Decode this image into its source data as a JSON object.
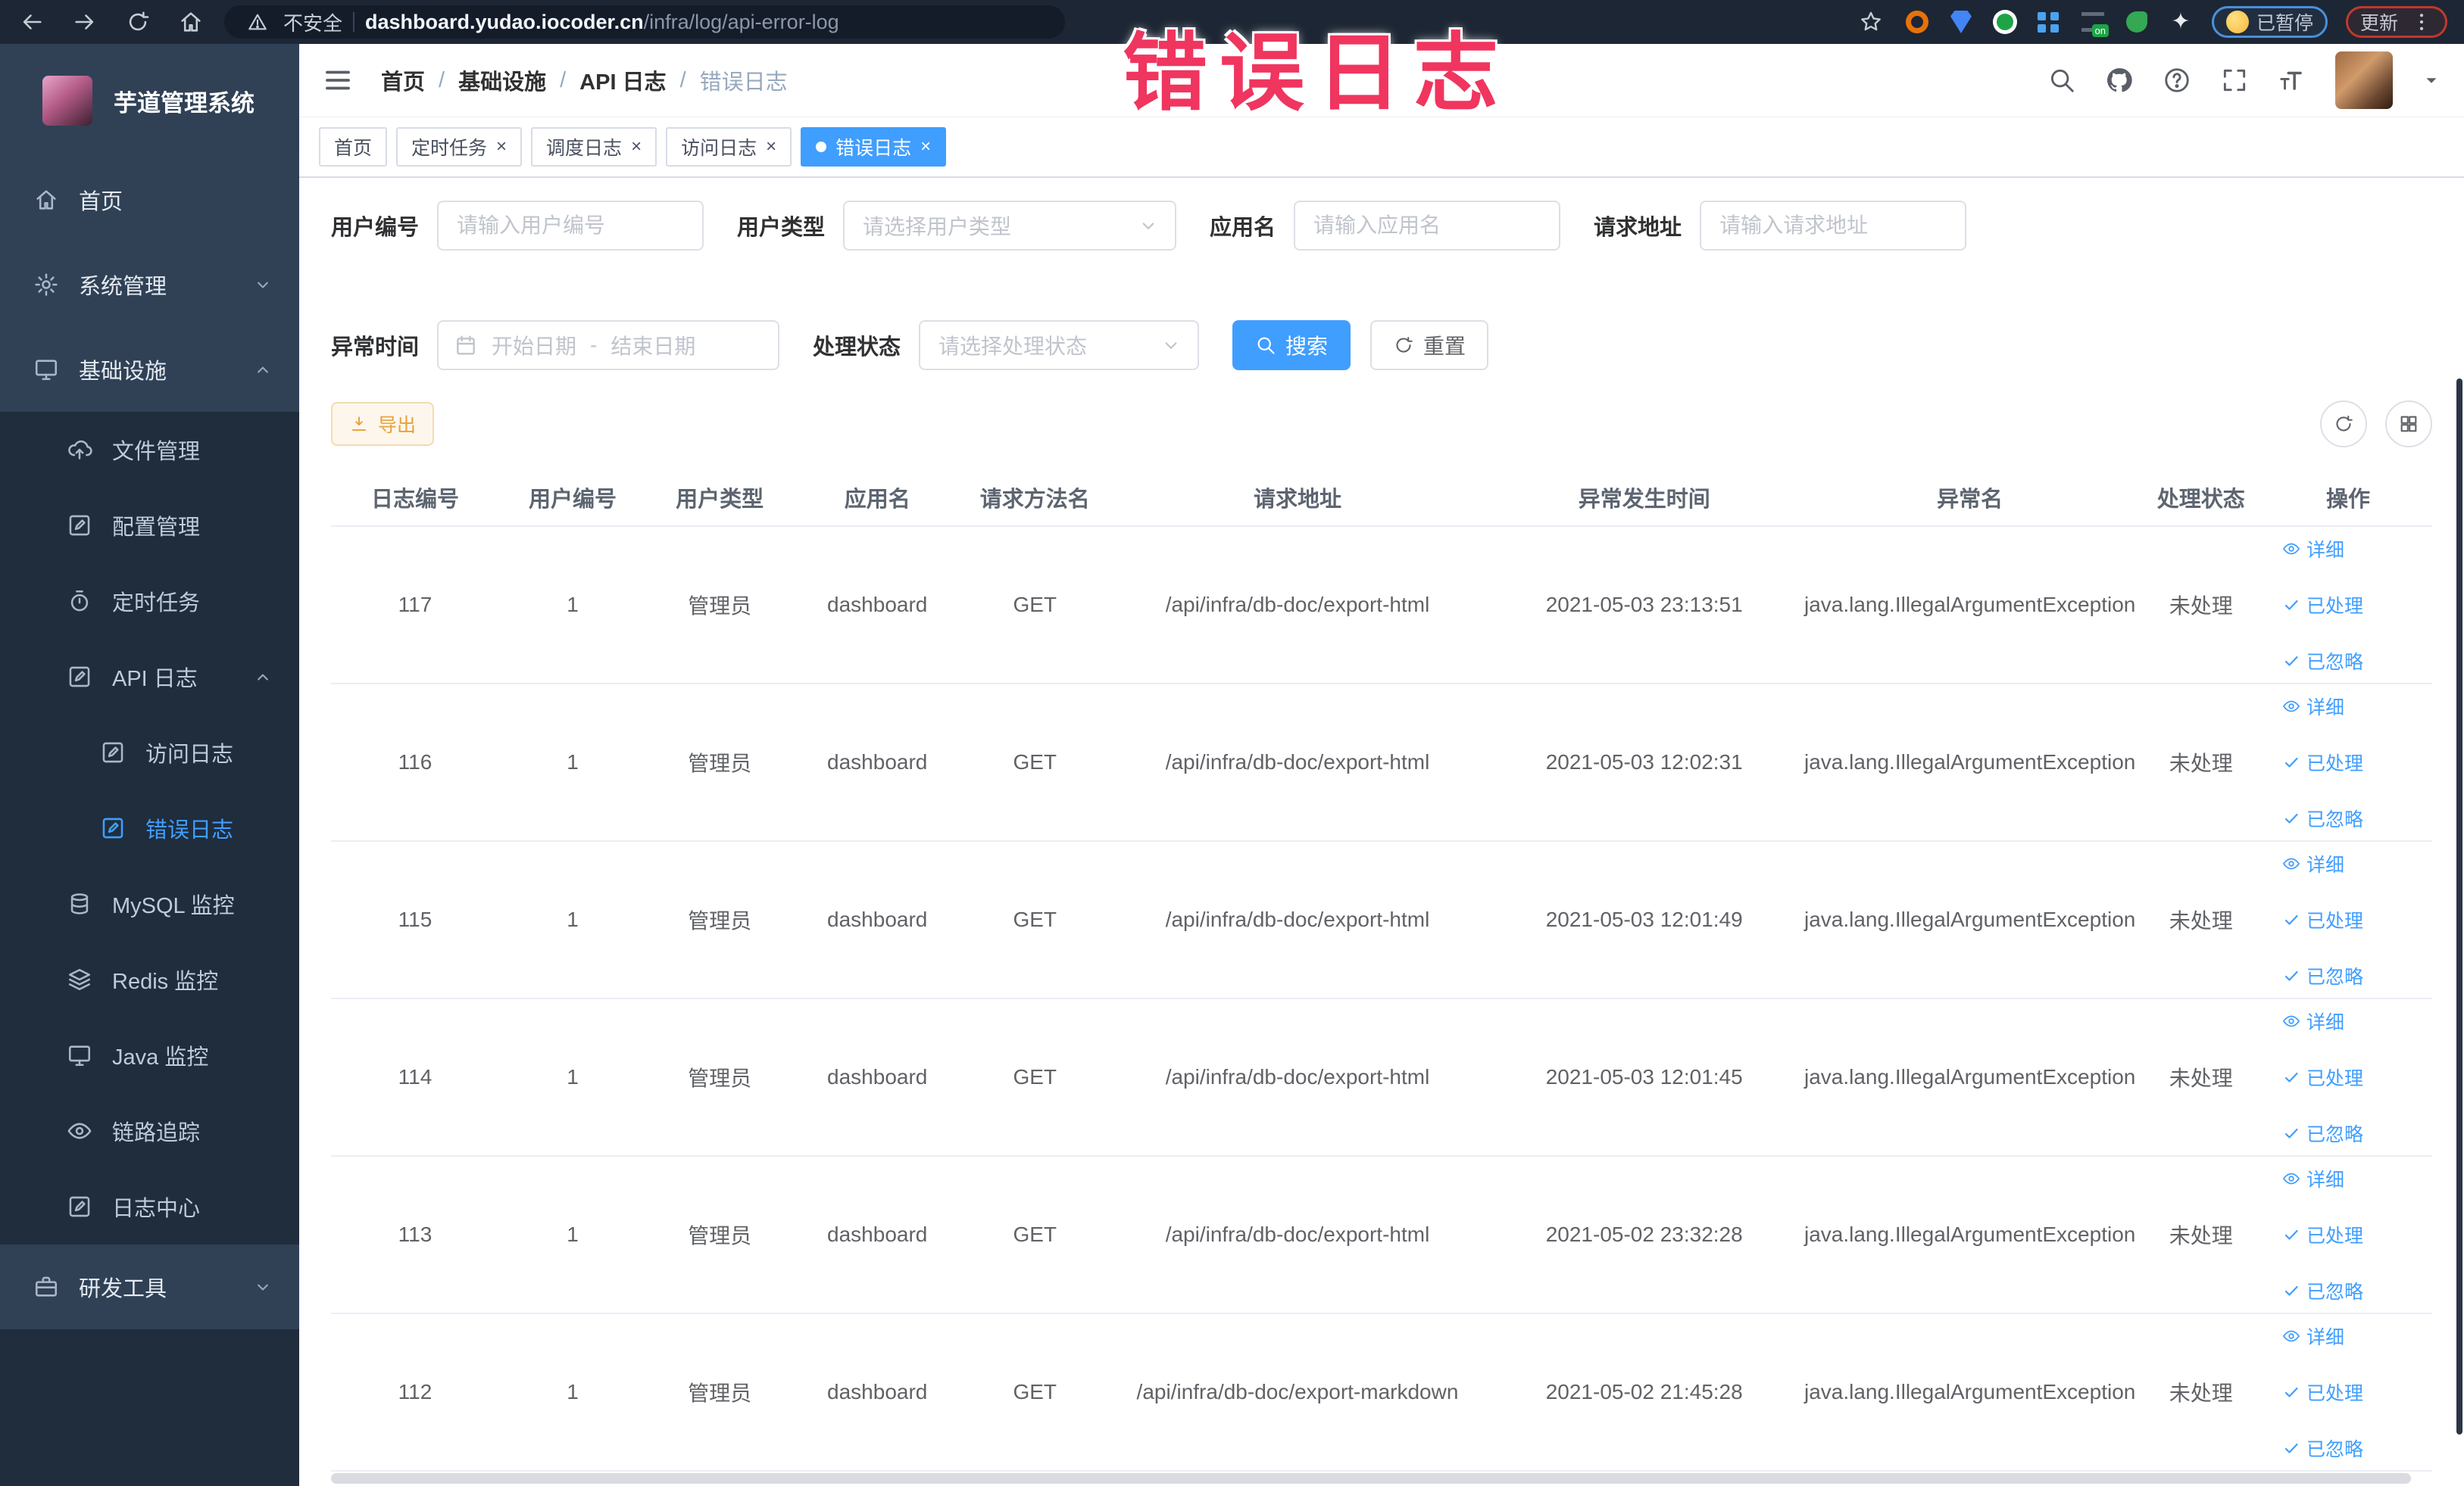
{
  "browser": {
    "security_label": "不安全",
    "url_host": "dashboard.yudao.iocoder.cn",
    "url_path": "/infra/log/api-error-log",
    "paused_badge": "已暂停",
    "update_badge": "更新",
    "nav_icons": [
      "back-icon",
      "forward-icon",
      "reload-icon",
      "home-icon"
    ],
    "extension_icons": [
      "star-icon",
      "orange-extension-icon",
      "shield-extension-icon",
      "green-extension-icon",
      "grid-extension-icon",
      "switch-extension-icon",
      "leaf-extension-icon",
      "puzzle-extension-icon",
      "emoji-extension-icon"
    ]
  },
  "annotation": {
    "text": "错误日志",
    "color": "#f0355f"
  },
  "sidebar": {
    "title": "芋道管理系统",
    "items": [
      {
        "name": "home",
        "label": "首页",
        "icon": "home",
        "level": 1
      },
      {
        "name": "system-management",
        "label": "系统管理",
        "icon": "gear",
        "level": 1,
        "chevron": "down"
      },
      {
        "name": "infrastructure",
        "label": "基础设施",
        "icon": "monitor",
        "level": 1,
        "chevron": "up"
      },
      {
        "name": "file-management",
        "label": "文件管理",
        "icon": "upload",
        "level": 2
      },
      {
        "name": "config-management",
        "label": "配置管理",
        "icon": "edit",
        "level": 2
      },
      {
        "name": "scheduled-tasks",
        "label": "定时任务",
        "icon": "timer",
        "level": 2
      },
      {
        "name": "api-log",
        "label": "API 日志",
        "icon": "log",
        "level": 2,
        "chevron": "up"
      },
      {
        "name": "access-log",
        "label": "访问日志",
        "icon": "log",
        "level": 3
      },
      {
        "name": "error-log",
        "label": "错误日志",
        "icon": "log",
        "level": 3,
        "active": true
      },
      {
        "name": "mysql-monitor",
        "label": "MySQL 监控",
        "icon": "database",
        "level": 2
      },
      {
        "name": "redis-monitor",
        "label": "Redis 监控",
        "icon": "layers",
        "level": 2
      },
      {
        "name": "java-monitor",
        "label": "Java 监控",
        "icon": "monitor",
        "level": 2
      },
      {
        "name": "trace",
        "label": "链路追踪",
        "icon": "eye",
        "level": 2
      },
      {
        "name": "log-center",
        "label": "日志中心",
        "icon": "log",
        "level": 2
      },
      {
        "name": "dev-tools",
        "label": "研发工具",
        "icon": "briefcase",
        "level": 1,
        "chevron": "down"
      }
    ]
  },
  "header": {
    "breadcrumb": [
      "首页",
      "基础设施",
      "API 日志",
      "错误日志"
    ],
    "icons": [
      "search-icon",
      "github-icon",
      "question-icon",
      "fullscreen-icon",
      "font-size-icon"
    ]
  },
  "tabs": [
    {
      "name": "home",
      "label": "首页",
      "closable": false,
      "active": false
    },
    {
      "name": "scheduled-tasks",
      "label": "定时任务",
      "closable": true,
      "active": false
    },
    {
      "name": "schedule-log",
      "label": "调度日志",
      "closable": true,
      "active": false
    },
    {
      "name": "access-log",
      "label": "访问日志",
      "closable": true,
      "active": false
    },
    {
      "name": "error-log",
      "label": "错误日志",
      "closable": true,
      "active": true
    }
  ],
  "filters": {
    "user_id": {
      "label": "用户编号",
      "placeholder": "请输入用户编号"
    },
    "user_type": {
      "label": "用户类型",
      "placeholder": "请选择用户类型"
    },
    "app_name": {
      "label": "应用名",
      "placeholder": "请输入应用名"
    },
    "request_url": {
      "label": "请求地址",
      "placeholder": "请输入请求地址"
    },
    "exception_time": {
      "label": "异常时间",
      "start_placeholder": "开始日期",
      "separator": "-",
      "end_placeholder": "结束日期"
    },
    "process_status": {
      "label": "处理状态",
      "placeholder": "请选择处理状态"
    },
    "search_label": "搜索",
    "reset_label": "重置"
  },
  "toolbar": {
    "export_label": "导出"
  },
  "table": {
    "columns": [
      "日志编号",
      "用户编号",
      "用户类型",
      "应用名",
      "请求方法名",
      "请求地址",
      "异常发生时间",
      "异常名",
      "处理状态",
      "操作"
    ],
    "actions": [
      {
        "name": "detail",
        "label": "详细",
        "icon": "eye"
      },
      {
        "name": "processed",
        "label": "已处理",
        "icon": "check"
      },
      {
        "name": "ignored",
        "label": "已忽略",
        "icon": "check"
      }
    ],
    "rows": [
      {
        "log_id": "117",
        "user_id": "1",
        "user_type": "管理员",
        "app_name": "dashboard",
        "method": "GET",
        "url": "/api/infra/db-doc/export-html",
        "time": "2021-05-03 23:13:51",
        "exception": "java.lang.IllegalArgumentException",
        "status": "未处理"
      },
      {
        "log_id": "116",
        "user_id": "1",
        "user_type": "管理员",
        "app_name": "dashboard",
        "method": "GET",
        "url": "/api/infra/db-doc/export-html",
        "time": "2021-05-03 12:02:31",
        "exception": "java.lang.IllegalArgumentException",
        "status": "未处理"
      },
      {
        "log_id": "115",
        "user_id": "1",
        "user_type": "管理员",
        "app_name": "dashboard",
        "method": "GET",
        "url": "/api/infra/db-doc/export-html",
        "time": "2021-05-03 12:01:49",
        "exception": "java.lang.IllegalArgumentException",
        "status": "未处理"
      },
      {
        "log_id": "114",
        "user_id": "1",
        "user_type": "管理员",
        "app_name": "dashboard",
        "method": "GET",
        "url": "/api/infra/db-doc/export-html",
        "time": "2021-05-03 12:01:45",
        "exception": "java.lang.IllegalArgumentException",
        "status": "未处理"
      },
      {
        "log_id": "113",
        "user_id": "1",
        "user_type": "管理员",
        "app_name": "dashboard",
        "method": "GET",
        "url": "/api/infra/db-doc/export-html",
        "time": "2021-05-02 23:32:28",
        "exception": "java.lang.IllegalArgumentException",
        "status": "未处理"
      },
      {
        "log_id": "112",
        "user_id": "1",
        "user_type": "管理员",
        "app_name": "dashboard",
        "method": "GET",
        "url": "/api/infra/db-doc/export-markdown",
        "time": "2021-05-02 21:45:28",
        "exception": "java.lang.IllegalArgumentException",
        "status": "未处理"
      }
    ]
  },
  "colors": {
    "primary": "#409eff",
    "sidebar_bg": "#304156",
    "sidebar_sub_bg": "#1f2d3d",
    "warning": "#e6a23c",
    "annotation_pink": "#f0355f"
  }
}
